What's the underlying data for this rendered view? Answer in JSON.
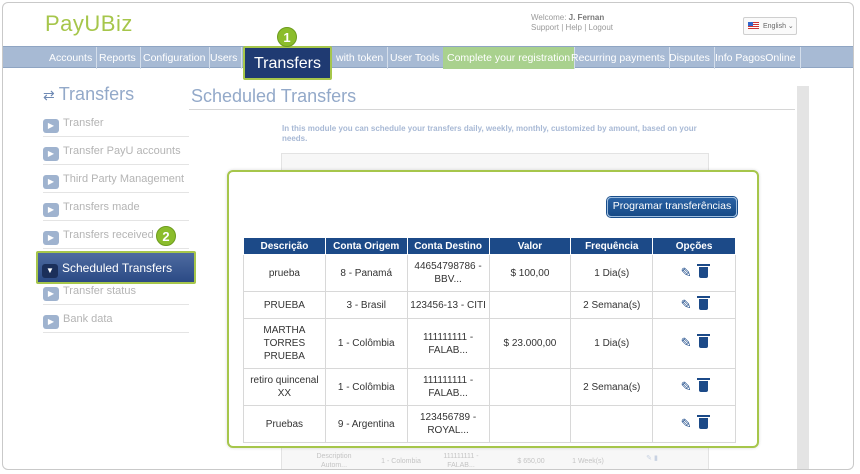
{
  "header": {
    "logo": "PayUBiz",
    "welcome_label": "Welcome:",
    "user": "J. Fernan",
    "links": "Support | Help | Logout",
    "language": "English"
  },
  "nav": [
    {
      "label": "Accounts"
    },
    {
      "label": "Reports"
    },
    {
      "label": "Configuration"
    },
    {
      "label": "Users"
    },
    {
      "label": "with token"
    },
    {
      "label": "User Tools"
    },
    {
      "label": "Complete your registration"
    },
    {
      "label": "Recurring payments"
    },
    {
      "label": "Disputes"
    },
    {
      "label": "Info PagosOnline"
    }
  ],
  "callout": {
    "transfers_label": "Transfers",
    "badge1": "1",
    "badge2": "2"
  },
  "sidebar": {
    "title": "Transfers",
    "items": [
      {
        "label": "Transfer"
      },
      {
        "label": "Transfer PayU accounts"
      },
      {
        "label": "Third Party Management"
      },
      {
        "label": "Transfers made"
      },
      {
        "label": "Transfers received"
      },
      {
        "label": "Scheduled Transfers"
      },
      {
        "label": "Transfer status"
      },
      {
        "label": "Bank data"
      }
    ]
  },
  "main": {
    "title": "Scheduled Transfers",
    "intro": "In this module you can schedule your transfers daily, weekly, monthly, customized by amount, based on your needs.",
    "schedule_button": "Programar transferências",
    "columns": [
      "Descrição",
      "Conta Origem",
      "Conta Destino",
      "Valor",
      "Frequência",
      "Opções"
    ],
    "rows": [
      {
        "descricao": "prueba",
        "origem": "8 - Panamá",
        "destino": "44654798786 - BBV...",
        "valor": "$ 100,00",
        "frequencia": "1 Dia(s)"
      },
      {
        "descricao": "PRUEBA",
        "origem": "3 - Brasil",
        "destino": "123456-13 - CITI",
        "valor": "",
        "frequencia": "2 Semana(s)"
      },
      {
        "descricao": "MARTHA TORRES PRUEBA",
        "origem": "1 - Colômbia",
        "destino": "111111111 - FALAB...",
        "valor": "$ 23.000,00",
        "frequencia": "1 Dia(s)"
      },
      {
        "descricao": "retiro quincenal XX",
        "origem": "1 - Colômbia",
        "destino": "111111111 - FALAB...",
        "valor": "",
        "frequencia": "2 Semana(s)"
      },
      {
        "descricao": "Pruebas",
        "origem": "9 - Argentina",
        "destino": "123456789 - ROYAL...",
        "valor": "",
        "frequencia": ""
      }
    ],
    "background_row": {
      "descricao": "Description Autom...",
      "origem": "1 - Colombia",
      "destino": "111111111 - FALAB...",
      "valor": "$ 650,00",
      "frequencia": "1 Week(s)"
    }
  }
}
